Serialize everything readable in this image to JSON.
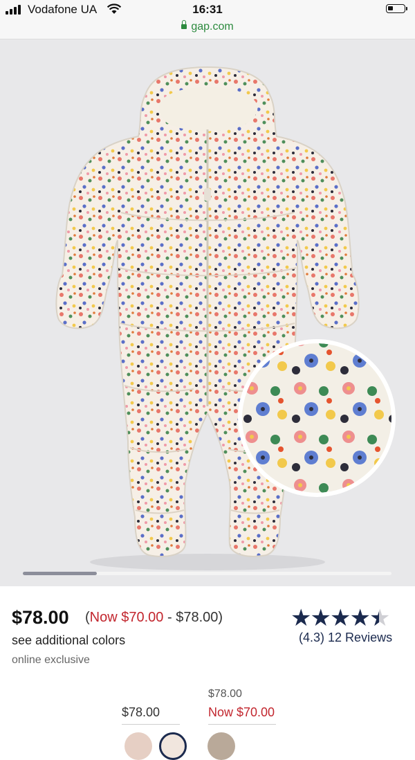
{
  "status_bar": {
    "carrier": "Vodafone UA",
    "time": "16:31",
    "url": "gap.com",
    "battery_level": 0.2
  },
  "product": {
    "image_alt": "Floral puffer snowsuit",
    "price": "$78.00",
    "price_range": {
      "open": "(",
      "now_label": "Now $70.00",
      "separator": " - ",
      "high": "$78.00",
      "close": ")"
    },
    "colors_link": "see additional colors",
    "exclusive_label": "online exclusive",
    "rating": {
      "value": 4.3,
      "label": "(4.3)",
      "reviews": "12 Reviews"
    },
    "gallery_progress": 0.2
  },
  "swatches": {
    "price_1": "$78.00",
    "was_price": "$78.00",
    "now_price": "Now $70.00"
  },
  "colors": {
    "accent_navy": "#1b2a4e",
    "sale_red": "#c2262e",
    "secure_green": "#2c8a3e"
  }
}
